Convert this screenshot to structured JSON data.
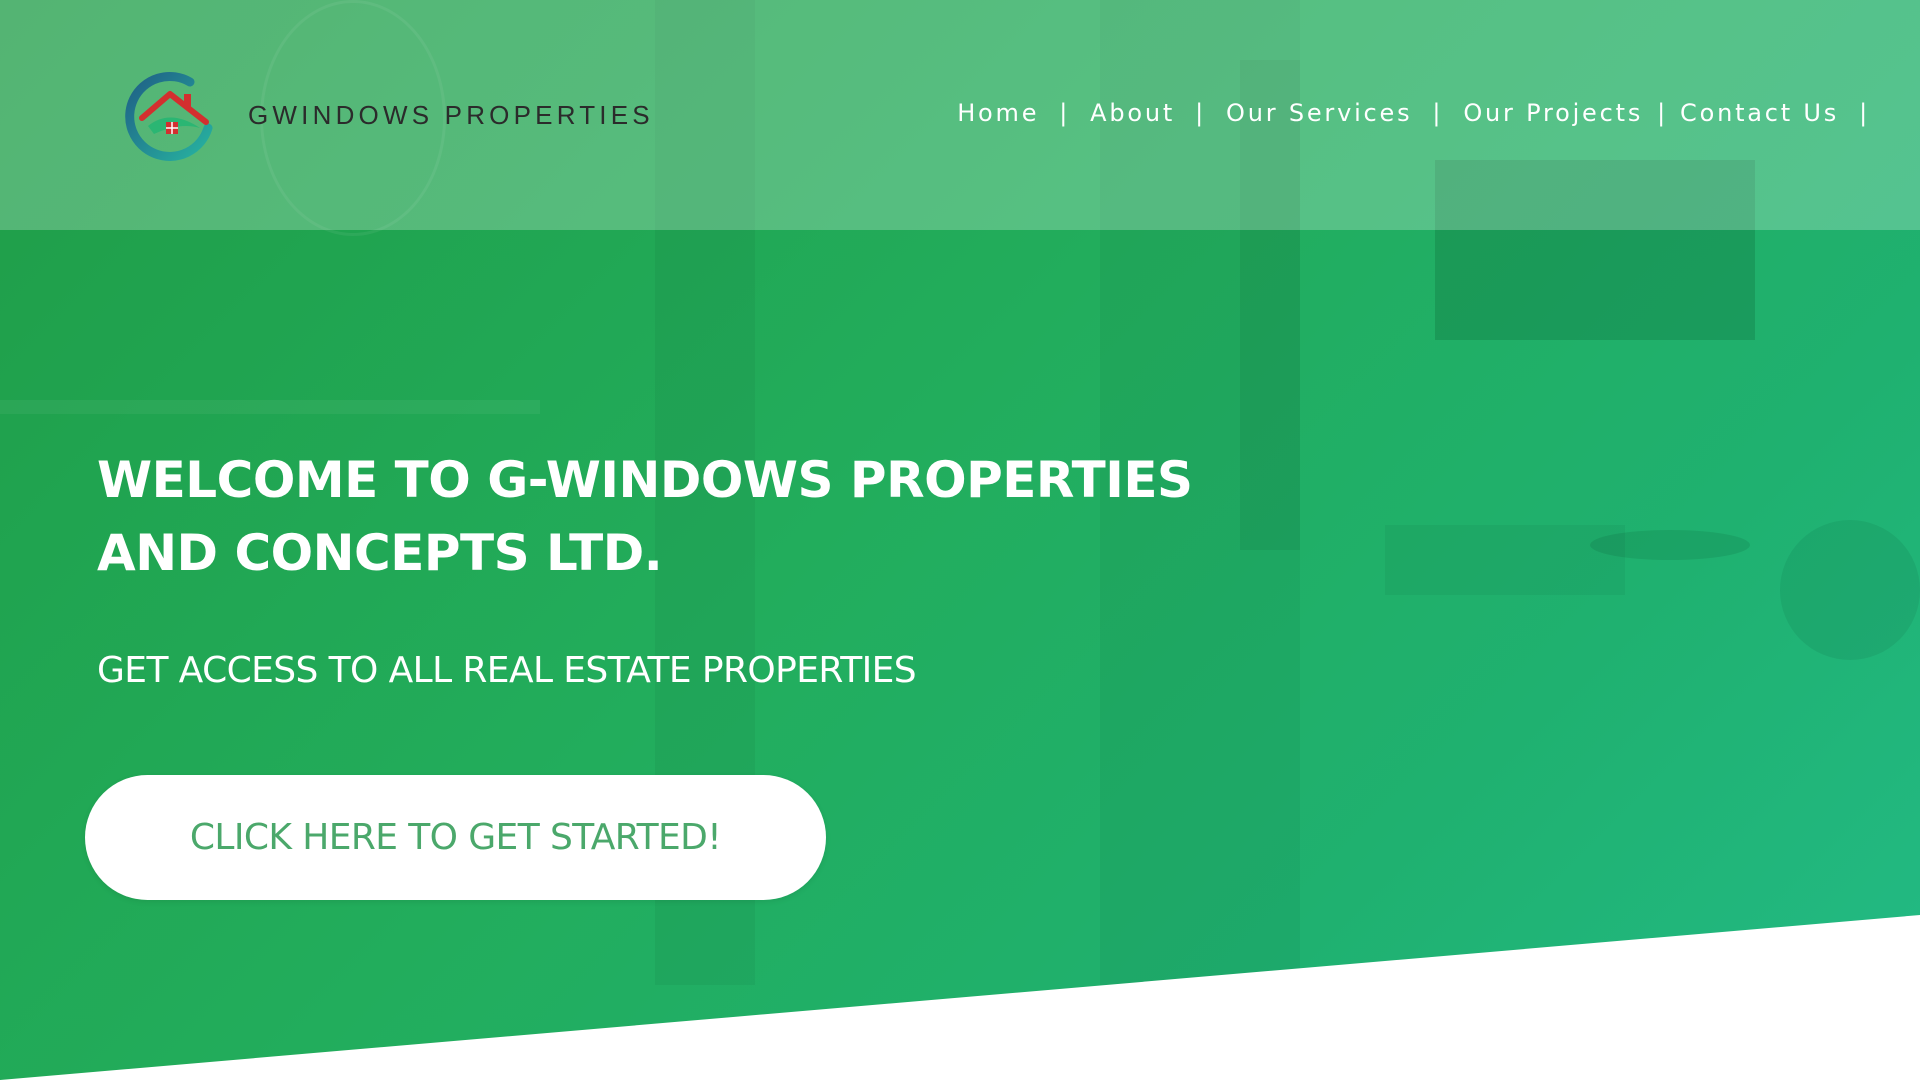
{
  "header": {
    "brand_name": "GWINDOWS PROPERTIES",
    "logo_icon": "house-logo-icon",
    "nav": [
      {
        "label": "Home"
      },
      {
        "label": "About"
      },
      {
        "label": "Our Services"
      },
      {
        "label": "Our Projects"
      },
      {
        "label": "Contact Us"
      }
    ],
    "separator": "|"
  },
  "hero": {
    "headline_line1": "WELCOME TO G-WINDOWS PROPERTIES",
    "headline_line2": "AND CONCEPTS LTD.",
    "subtitle": "GET ACCESS TO ALL REAL ESTATE PROPERTIES",
    "cta_label": "CLICK HERE TO GET STARTED!"
  },
  "colors": {
    "primary_green": "#22ad5c",
    "cta_text": "#4ba86b",
    "logo_ring": "#1f6f7a",
    "logo_roof": "#d32f2f",
    "logo_base": "#2bb673"
  }
}
